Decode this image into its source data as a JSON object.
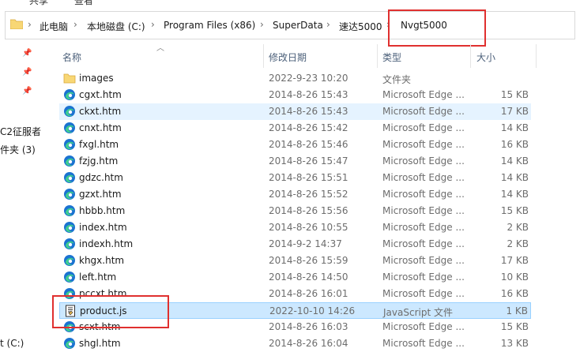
{
  "ribbon": {
    "share": "共享",
    "view": "查看"
  },
  "address": {
    "crumbs": [
      "此电脑",
      "本地磁盘 (C:)",
      "Program Files (x86)",
      "SuperData",
      "速达5000",
      "Nvgt5000"
    ]
  },
  "navpane": {
    "items": [
      "C2征服者",
      "件夹 (3)",
      "t (C:)"
    ]
  },
  "columns": {
    "name": "名称",
    "date": "修改日期",
    "type": "类型",
    "size": "大小"
  },
  "files": [
    {
      "name": "images",
      "date": "2022-9-23 10:20",
      "type": "文件夹",
      "size": "",
      "icon": "folder-icon"
    },
    {
      "name": "cgxt.htm",
      "date": "2014-8-26 15:43",
      "type": "Microsoft Edge ...",
      "size": "15 KB",
      "icon": "edge-icon"
    },
    {
      "name": "ckxt.htm",
      "date": "2014-8-26 15:43",
      "type": "Microsoft Edge ...",
      "size": "17 KB",
      "icon": "edge-icon"
    },
    {
      "name": "cnxt.htm",
      "date": "2014-8-26 15:42",
      "type": "Microsoft Edge ...",
      "size": "14 KB",
      "icon": "edge-icon"
    },
    {
      "name": "fxgl.htm",
      "date": "2014-8-26 15:46",
      "type": "Microsoft Edge ...",
      "size": "16 KB",
      "icon": "edge-icon"
    },
    {
      "name": "fzjg.htm",
      "date": "2014-8-26 15:47",
      "type": "Microsoft Edge ...",
      "size": "14 KB",
      "icon": "edge-icon"
    },
    {
      "name": "gdzc.htm",
      "date": "2014-8-26 15:51",
      "type": "Microsoft Edge ...",
      "size": "14 KB",
      "icon": "edge-icon"
    },
    {
      "name": "gzxt.htm",
      "date": "2014-8-26 15:52",
      "type": "Microsoft Edge ...",
      "size": "14 KB",
      "icon": "edge-icon"
    },
    {
      "name": "hbbb.htm",
      "date": "2014-8-26 15:56",
      "type": "Microsoft Edge ...",
      "size": "15 KB",
      "icon": "edge-icon"
    },
    {
      "name": "index.htm",
      "date": "2014-8-26 10:55",
      "type": "Microsoft Edge ...",
      "size": "2 KB",
      "icon": "edge-icon"
    },
    {
      "name": "indexh.htm",
      "date": "2014-9-2 14:37",
      "type": "Microsoft Edge ...",
      "size": "2 KB",
      "icon": "edge-icon"
    },
    {
      "name": "khgx.htm",
      "date": "2014-8-26 15:59",
      "type": "Microsoft Edge ...",
      "size": "17 KB",
      "icon": "edge-icon"
    },
    {
      "name": "left.htm",
      "date": "2014-8-26 14:50",
      "type": "Microsoft Edge ...",
      "size": "10 KB",
      "icon": "edge-icon"
    },
    {
      "name": "pccxt.htm",
      "date": "2014-8-26 16:01",
      "type": "Microsoft Edge ...",
      "size": "16 KB",
      "icon": "edge-icon"
    },
    {
      "name": "product.js",
      "date": "2022-10-10 14:26",
      "type": "JavaScript 文件",
      "size": "1 KB",
      "icon": "script-file-icon"
    },
    {
      "name": "scxt.htm",
      "date": "2014-8-26 16:03",
      "type": "Microsoft Edge ...",
      "size": "15 KB",
      "icon": "edge-icon"
    },
    {
      "name": "shgl.htm",
      "date": "2014-8-26 16:04",
      "type": "Microsoft Edge ...",
      "size": "13 KB",
      "icon": "edge-icon"
    }
  ],
  "hover_row": 2,
  "selected_row": 14,
  "colors": {
    "highlight_box": "#e0302f",
    "selection": "#cce8ff",
    "hover": "#e5f3ff",
    "folder": "#f8d775",
    "edge_blue": "#1b73d1",
    "edge_green": "#3fcf8e"
  }
}
